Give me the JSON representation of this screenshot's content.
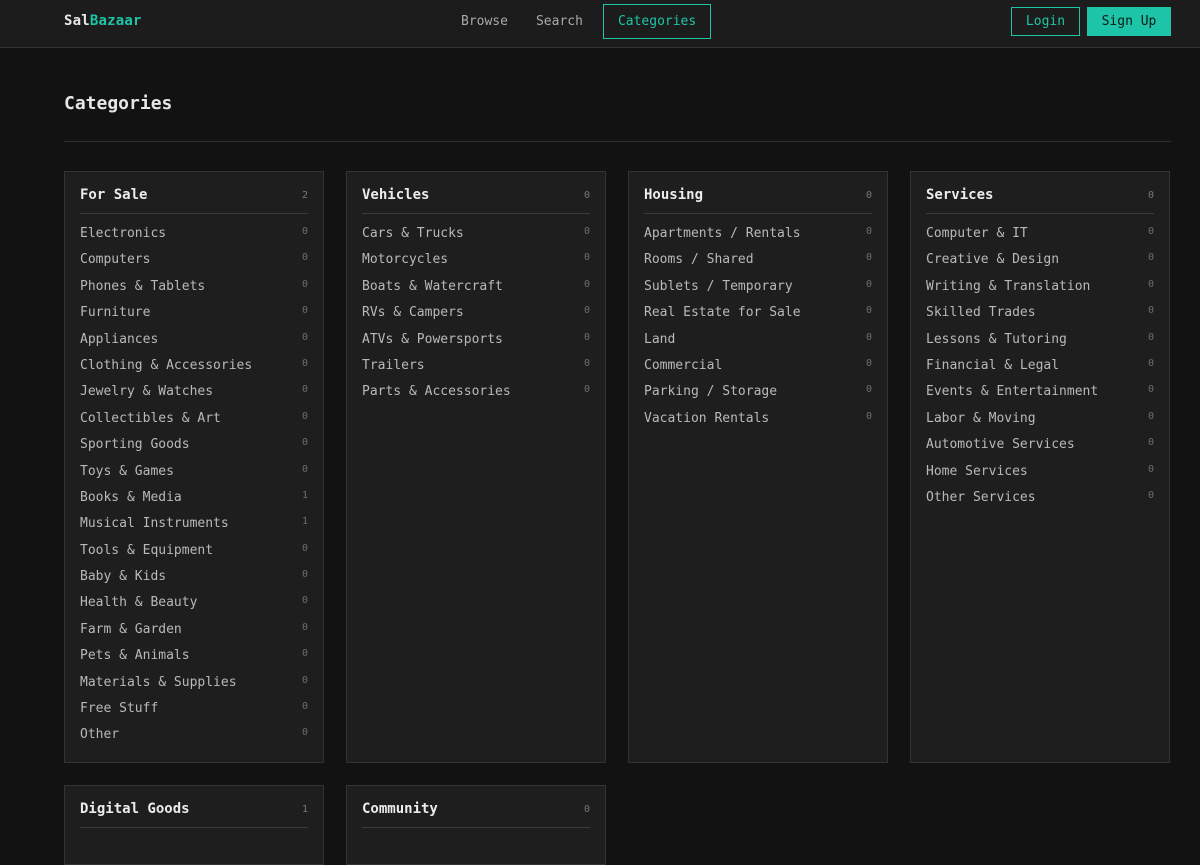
{
  "header": {
    "logo_part1": "Sal",
    "logo_part2": "Bazaar",
    "nav": [
      "Browse",
      "Search",
      "Categories"
    ],
    "login_label": "Login",
    "signup_label": "Sign Up",
    "accent_color": "#1dc4a8"
  },
  "page": {
    "title": "Categories"
  },
  "cards": [
    {
      "title": "For Sale",
      "count": "2",
      "items": [
        {
          "label": "Electronics",
          "count": "0"
        },
        {
          "label": "Computers",
          "count": "0"
        },
        {
          "label": "Phones & Tablets",
          "count": "0"
        },
        {
          "label": "Furniture",
          "count": "0"
        },
        {
          "label": "Appliances",
          "count": "0"
        },
        {
          "label": "Clothing & Accessories",
          "count": "0"
        },
        {
          "label": "Jewelry & Watches",
          "count": "0"
        },
        {
          "label": "Collectibles & Art",
          "count": "0"
        },
        {
          "label": "Sporting Goods",
          "count": "0"
        },
        {
          "label": "Toys & Games",
          "count": "0"
        },
        {
          "label": "Books & Media",
          "count": "1"
        },
        {
          "label": "Musical Instruments",
          "count": "1"
        },
        {
          "label": "Tools & Equipment",
          "count": "0"
        },
        {
          "label": "Baby & Kids",
          "count": "0"
        },
        {
          "label": "Health & Beauty",
          "count": "0"
        },
        {
          "label": "Farm & Garden",
          "count": "0"
        },
        {
          "label": "Pets & Animals",
          "count": "0"
        },
        {
          "label": "Materials & Supplies",
          "count": "0"
        },
        {
          "label": "Free Stuff",
          "count": "0"
        },
        {
          "label": "Other",
          "count": "0"
        }
      ]
    },
    {
      "title": "Vehicles",
      "count": "0",
      "items": [
        {
          "label": "Cars & Trucks",
          "count": "0"
        },
        {
          "label": "Motorcycles",
          "count": "0"
        },
        {
          "label": "Boats & Watercraft",
          "count": "0"
        },
        {
          "label": "RVs & Campers",
          "count": "0"
        },
        {
          "label": "ATVs & Powersports",
          "count": "0"
        },
        {
          "label": "Trailers",
          "count": "0"
        },
        {
          "label": "Parts & Accessories",
          "count": "0"
        }
      ]
    },
    {
      "title": "Housing",
      "count": "0",
      "items": [
        {
          "label": "Apartments / Rentals",
          "count": "0"
        },
        {
          "label": "Rooms / Shared",
          "count": "0"
        },
        {
          "label": "Sublets / Temporary",
          "count": "0"
        },
        {
          "label": "Real Estate for Sale",
          "count": "0"
        },
        {
          "label": "Land",
          "count": "0"
        },
        {
          "label": "Commercial",
          "count": "0"
        },
        {
          "label": "Parking / Storage",
          "count": "0"
        },
        {
          "label": "Vacation Rentals",
          "count": "0"
        }
      ]
    },
    {
      "title": "Services",
      "count": "0",
      "items": [
        {
          "label": "Computer & IT",
          "count": "0"
        },
        {
          "label": "Creative & Design",
          "count": "0"
        },
        {
          "label": "Writing & Translation",
          "count": "0"
        },
        {
          "label": "Skilled Trades",
          "count": "0"
        },
        {
          "label": "Lessons & Tutoring",
          "count": "0"
        },
        {
          "label": "Financial & Legal",
          "count": "0"
        },
        {
          "label": "Events & Entertainment",
          "count": "0"
        },
        {
          "label": "Labor & Moving",
          "count": "0"
        },
        {
          "label": "Automotive Services",
          "count": "0"
        },
        {
          "label": "Home Services",
          "count": "0"
        },
        {
          "label": "Other Services",
          "count": "0"
        }
      ]
    },
    {
      "title": "Digital Goods",
      "count": "1",
      "items": []
    },
    {
      "title": "Community",
      "count": "0",
      "items": []
    }
  ]
}
